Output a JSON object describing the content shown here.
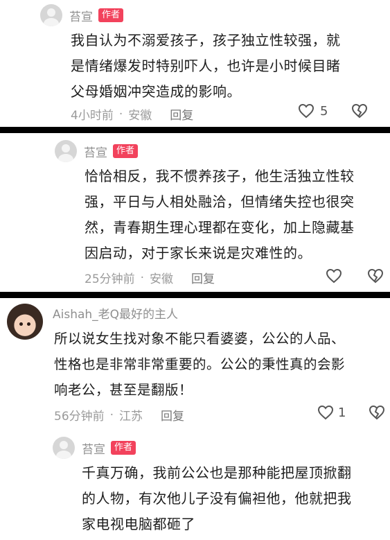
{
  "comments": [
    {
      "author": "苔宣",
      "badge": "作者",
      "text": [
        "我自认为不溺爱孩子，孩子独立性较强，就",
        "是情绪爆发时特别吓人，也许是小时候目睹",
        "父母婚姻冲突造成的影响。"
      ],
      "time": "4小时前",
      "location": "安徽",
      "reply_label": "回复",
      "like_count": "5",
      "dot": "·"
    },
    {
      "author": "苔宣",
      "badge": "作者",
      "text": [
        "恰恰相反，我不惯养孩子，他生活独立性较",
        "强，平日与人相处融洽，但情绪失控也很突",
        "然，青春期生理心理都在变化，加上隐藏基",
        "因启动，对于家长来说是灾难性的。"
      ],
      "time": "25分钟前",
      "location": "安徽",
      "reply_label": "回复",
      "like_count": "",
      "dot": "·"
    },
    {
      "author": "Aishah_老Q最好的主人",
      "text": [
        "所以说女生找对象不能只看婆婆，公公的人品、",
        "性格也是非常非常重要的。公公的秉性真的会影",
        "响老公，甚至是翻版！"
      ],
      "time": "56分钟前",
      "location": "江苏",
      "reply_label": "回复",
      "like_count": "1",
      "dot": "·"
    },
    {
      "author": "苔宣",
      "badge": "作者",
      "text": [
        "千真万确，我前公公也是那种能把屋顶掀翻",
        "的人物，有次他儿子没有偏袒他，他就把我",
        "家电视电脑都砸了"
      ]
    }
  ],
  "colors": {
    "badge": "#f2425c",
    "separator": "#000000",
    "meta": "#9a9a9a"
  },
  "icons": [
    "user-avatar-icon",
    "heart-icon",
    "broken-heart-icon"
  ]
}
